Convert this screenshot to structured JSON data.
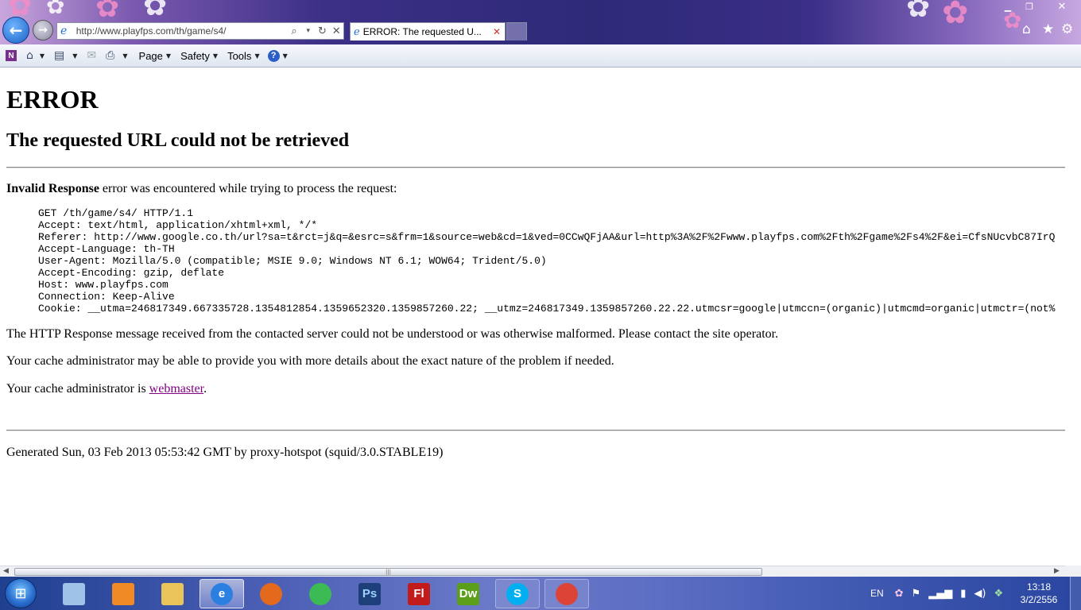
{
  "browser": {
    "address": "http://www.playfps.com/th/game/s4/",
    "tab_title": "ERROR: The requested U...",
    "commands": {
      "page": "Page",
      "safety": "Safety",
      "tools": "Tools"
    }
  },
  "page": {
    "heading": "ERROR",
    "subheading": "The requested URL could not be retrieved",
    "intro_strong": "Invalid Response",
    "intro_rest": " error was encountered while trying to process the request:",
    "request_lines": [
      "GET /th/game/s4/ HTTP/1.1",
      "Accept: text/html, application/xhtml+xml, */*",
      "Referer: http://www.google.co.th/url?sa=t&rct=j&q=&esrc=s&frm=1&source=web&cd=1&ved=0CCwQFjAA&url=http%3A%2F%2Fwww.playfps.com%2Fth%2Fgame%2Fs4%2F&ei=CfsNUcvbC87IrQ",
      "Accept-Language: th-TH",
      "User-Agent: Mozilla/5.0 (compatible; MSIE 9.0; Windows NT 6.1; WOW64; Trident/5.0)",
      "Accept-Encoding: gzip, deflate",
      "Host: www.playfps.com",
      "Connection: Keep-Alive",
      "Cookie: __utma=246817349.667335728.1354812854.1359652320.1359857260.22; __utmz=246817349.1359857260.22.22.utmcsr=google|utmccn=(organic)|utmcmd=organic|utmctr=(not%"
    ],
    "description": "The HTTP Response message received from the contacted server could not be understood or was otherwise malformed. Please contact the site operator.",
    "cache_info": "Your cache administrator may be able to provide you with more details about the exact nature of the problem if needed.",
    "admin_prefix": "Your cache administrator is ",
    "admin_link": "webmaster",
    "admin_suffix": ".",
    "footer": "Generated Sun, 03 Feb 2013 05:53:42 GMT by proxy-hotspot (squid/3.0.STABLE19)"
  },
  "taskbar": {
    "apps": [
      {
        "name": "control-panel",
        "label": "",
        "color": "#9fc3e8",
        "state": "normal"
      },
      {
        "name": "media-player",
        "label": "",
        "color": "#f08a24",
        "state": "normal"
      },
      {
        "name": "explorer",
        "label": "",
        "color": "#e8c45a",
        "state": "normal"
      },
      {
        "name": "internet-explorer",
        "label": "e",
        "color": "#2a7fe0",
        "state": "active"
      },
      {
        "name": "firefox",
        "label": "",
        "color": "#e36a1c",
        "state": "normal"
      },
      {
        "name": "chrome",
        "label": "",
        "color": "#3cba54",
        "state": "normal"
      },
      {
        "name": "photoshop",
        "label": "Ps",
        "color": "#1d3f7a",
        "state": "normal"
      },
      {
        "name": "flash",
        "label": "Fl",
        "color": "#c21b1b",
        "state": "normal"
      },
      {
        "name": "dreamweaver",
        "label": "Dw",
        "color": "#5a9e1a",
        "state": "normal"
      },
      {
        "name": "skype",
        "label": "S",
        "color": "#00aff0",
        "state": "open"
      },
      {
        "name": "chrome-2",
        "label": "",
        "color": "#db4437",
        "state": "open"
      }
    ],
    "language": "EN",
    "time": "13:18",
    "date": "3/2/2556"
  }
}
